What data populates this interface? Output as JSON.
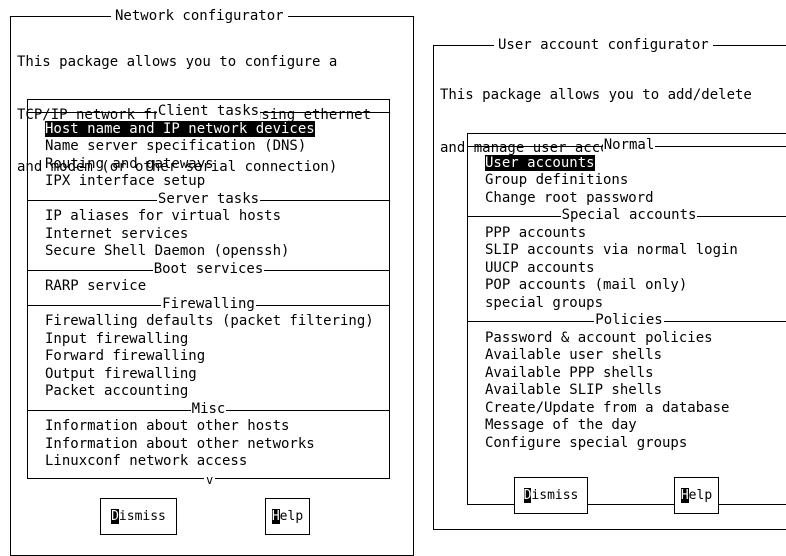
{
  "network": {
    "title": "Network configurator",
    "desc": [
      "This package allows you to configure a",
      "TCP/IP network from scratch using ethernet",
      "and modem (or other serial connection)"
    ],
    "sections": [
      {
        "title": "Client tasks",
        "items": [
          "Host name and IP network devices",
          "Name server specification (DNS)",
          "Routing and gateways",
          "IPX interface setup"
        ]
      },
      {
        "title": "Server tasks",
        "items": [
          "IP aliases for virtual hosts",
          "Internet services",
          "Secure Shell Daemon (openssh)"
        ]
      },
      {
        "title": "Boot services",
        "items": [
          "RARP service"
        ]
      },
      {
        "title": "Firewalling",
        "items": [
          "Firewalling defaults (packet filtering)",
          "Input firewalling",
          "Forward firewalling",
          "Output firewalling",
          "Packet accounting"
        ]
      },
      {
        "title": "Misc",
        "items": [
          "Information about other hosts",
          "Information about other networks",
          "Linuxconf network access"
        ]
      }
    ],
    "selected": "Host name and IP network devices",
    "scroll_marker": "v",
    "dismiss": {
      "hotkey": "D",
      "rest": "ismiss"
    },
    "help": {
      "hotkey": "H",
      "rest": "elp"
    }
  },
  "user": {
    "title": "User account configurator",
    "desc": [
      "This package allows you to add/delete",
      "and manage user accounts"
    ],
    "sections": [
      {
        "title": "Normal",
        "items": [
          "User accounts",
          "Group definitions",
          "Change root password"
        ]
      },
      {
        "title": "Special accounts",
        "items": [
          "PPP accounts",
          "SLIP accounts via normal login",
          "UUCP accounts",
          "POP accounts (mail only)",
          "special groups"
        ]
      },
      {
        "title": "Policies",
        "items": [
          "Password & account policies",
          "Available user shells",
          "Available PPP shells",
          "Available SLIP shells",
          "Create/Update from a database",
          "Message of the day",
          "Configure special groups"
        ]
      }
    ],
    "selected": "User accounts",
    "dismiss": {
      "hotkey": "D",
      "rest": "ismiss"
    },
    "help": {
      "hotkey": "H",
      "rest": "elp"
    }
  }
}
